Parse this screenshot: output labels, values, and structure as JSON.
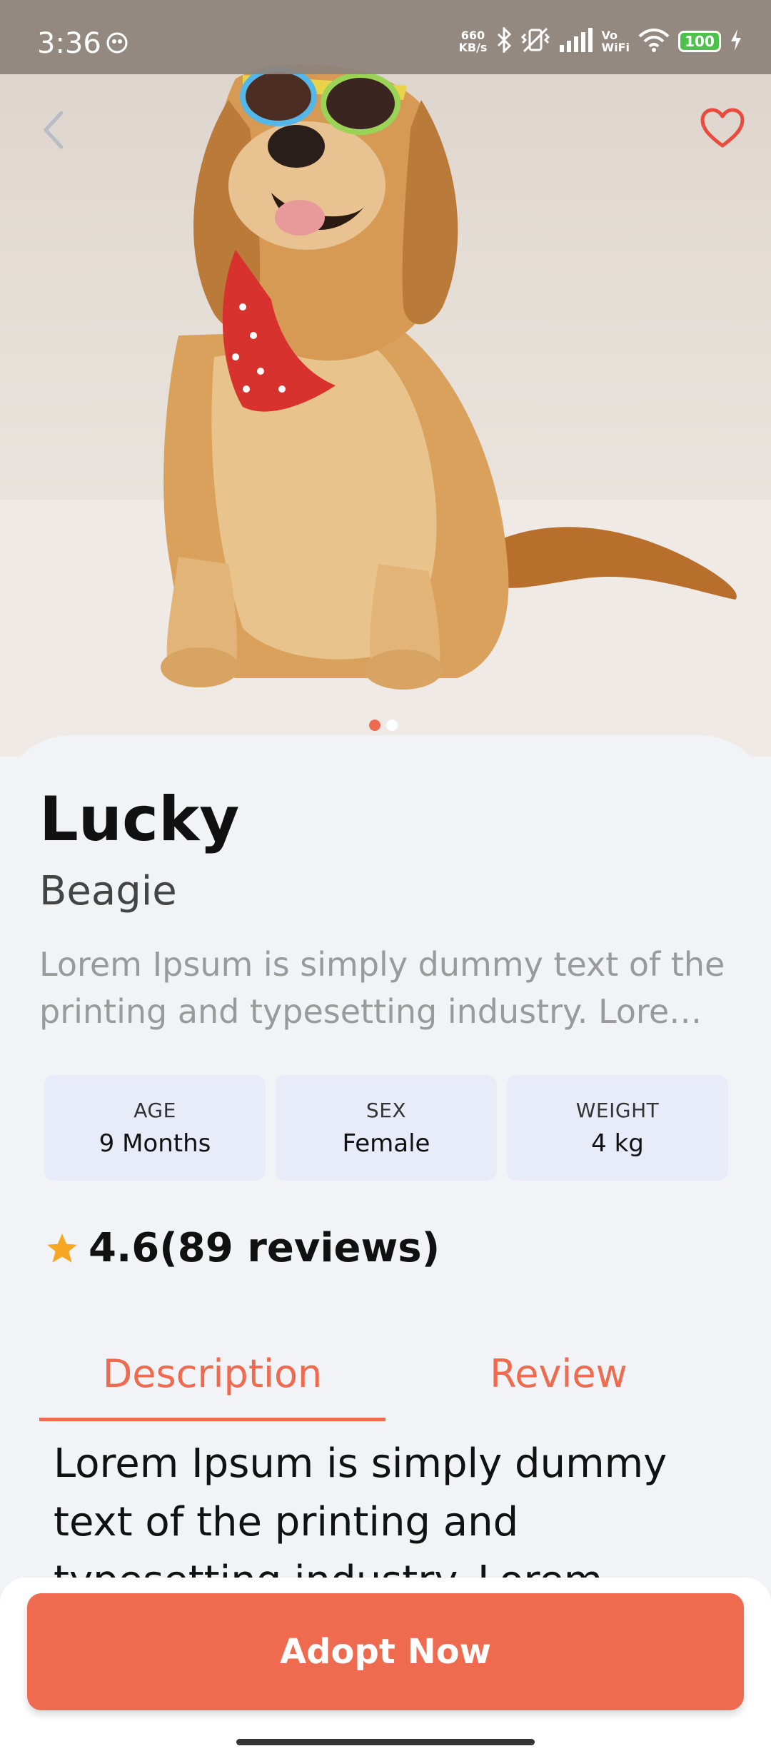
{
  "status_bar": {
    "time": "3:36",
    "net_speed_value": "660",
    "net_speed_unit": "KB/s",
    "vo_label": "Vo",
    "wifi_label": "WiFi",
    "battery": "100"
  },
  "hero": {
    "image": "golden-retriever-with-sunglasses-and-bandana",
    "page_indicator": {
      "total": 2,
      "active": 0
    },
    "active_dot_color": "#EF6B4F",
    "inactive_dot_color": "#FFFFFF"
  },
  "pet": {
    "name": "Lucky",
    "breed": "Beagie",
    "short_description": "Lorem Ipsum is simply dummy text of the printing and typesetting industry. Lorem Ipsum has been the industry's standard",
    "stats": [
      {
        "label": "AGE",
        "value": "9 Months"
      },
      {
        "label": "SEX",
        "value": "Female"
      },
      {
        "label": "WEIGHT",
        "value": "4 kg"
      }
    ],
    "rating_text": "4.6(89 reviews)"
  },
  "tabs": [
    {
      "label": "Description",
      "active": true
    },
    {
      "label": "Review",
      "active": false
    }
  ],
  "description_text": "Lorem Ipsum is simply dummy text of the printing and typesetting industry. Lorem Ipsum",
  "cta": {
    "label": "Adopt Now"
  },
  "colors": {
    "accent": "#EF6B4F",
    "background": "#F1F3F6",
    "stat_card": "#E8EBF8",
    "star": "#F5A623"
  }
}
